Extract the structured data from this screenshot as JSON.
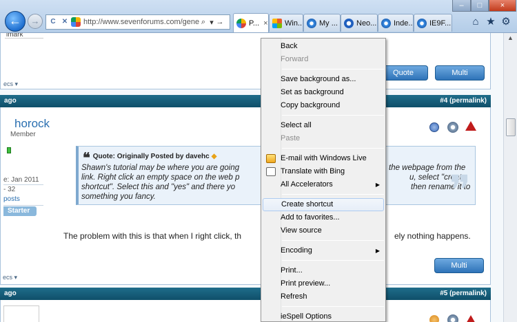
{
  "browser": {
    "address_url": "http://www.sevenforums.com/gener",
    "tabs": [
      {
        "label": "P...",
        "color": "#f4b400",
        "active": true
      },
      {
        "label": "Win...",
        "color": "#e85c2a"
      },
      {
        "label": "My ...",
        "color": "#3a8ee6"
      },
      {
        "label": "Neo...",
        "color": "#1f5fbf"
      },
      {
        "label": "Inde...",
        "color": "#3a8ee6"
      },
      {
        "label": "IE9F...",
        "color": "#3a8ee6"
      }
    ],
    "tab_close_glyph": "×",
    "window_buttons": {
      "minimize": "–",
      "maximize": "□",
      "close": "×"
    },
    "icons": {
      "back": "←",
      "forward": "→",
      "refresh": "C",
      "stop": "✕",
      "search": "⌕",
      "dropdown": "▾",
      "go": "→",
      "home": "⌂",
      "favorites": "★",
      "tools": "⚙"
    }
  },
  "page": {
    "top_fragment": "imark",
    "specs_label": "ecs",
    "buttons": {
      "quote": "Quote",
      "multi": "Multi"
    },
    "post4": {
      "header_left": "ago",
      "header_right": "#4 (permalink)"
    },
    "post5": {
      "header_left": "ago",
      "header_right": "#5 (permalink)"
    },
    "author": {
      "name": "horock",
      "title": "Member",
      "join_date": "e: Jan 2011",
      "posts_count": "- 32",
      "posts_link": "posts",
      "starter_badge": "Starter"
    },
    "quote": {
      "heading": "Quote: Originally Posted by davehc",
      "line1_a": "Shawn's tutorial may be where you are going",
      "line1_b": "the webpage from the",
      "line2_a": "link. Right click an empty space on the web p",
      "line2_b": "u, select \"create",
      "line3_a": "shortcut\". Select this and \"yes\" and there yo",
      "line3_b": "then rename it to",
      "line4": "something you fancy."
    },
    "message_a": "The problem with this is that when I right click, th",
    "message_b": "ely nothing happens."
  },
  "context_menu": {
    "items": [
      {
        "label": "Back",
        "disabled": false
      },
      {
        "label": "Forward",
        "disabled": true
      },
      {
        "label": "Save background as...",
        "disabled": false
      },
      {
        "label": "Set as background",
        "disabled": false
      },
      {
        "label": "Copy background",
        "disabled": false
      },
      {
        "label": "Select all",
        "disabled": false
      },
      {
        "label": "Paste",
        "disabled": true
      },
      {
        "label": "E-mail with Windows Live",
        "disabled": false
      },
      {
        "label": "Translate with Bing",
        "disabled": false
      },
      {
        "label": "All Accelerators",
        "disabled": false,
        "submenu": true
      },
      {
        "label": "Create shortcut",
        "disabled": false,
        "highlighted": true
      },
      {
        "label": "Add to favorites...",
        "disabled": false
      },
      {
        "label": "View source",
        "disabled": false
      },
      {
        "label": "Encoding",
        "disabled": false,
        "submenu": true
      },
      {
        "label": "Print...",
        "disabled": false
      },
      {
        "label": "Print preview...",
        "disabled": false
      },
      {
        "label": "Refresh",
        "disabled": false
      },
      {
        "label": "ieSpell Options",
        "disabled": false
      }
    ]
  }
}
